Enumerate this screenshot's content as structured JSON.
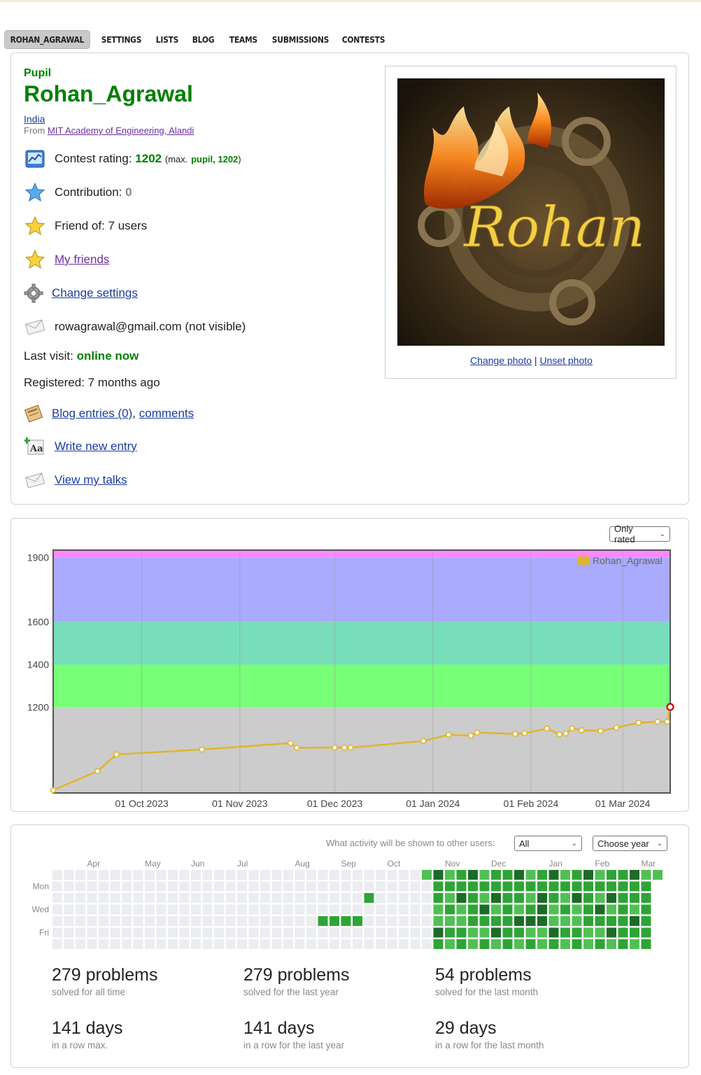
{
  "tabs": [
    "ROHAN_AGRAWAL",
    "SETTINGS",
    "LISTS",
    "BLOG",
    "TEAMS",
    "SUBMISSIONS",
    "CONTESTS"
  ],
  "profile": {
    "rank": "Pupil",
    "handle": "Rohan_Agrawal",
    "country": "India",
    "from_prefix": "From",
    "organization": "MIT Academy of Engineering, Alandi",
    "rating_label": "Contest rating:",
    "rating": "1202",
    "max_prefix": "(max.",
    "max_rank": "pupil, 1202",
    "max_suffix": ")",
    "contribution_label": "Contribution:",
    "contribution": "0",
    "friend_of": "Friend of: 7 users",
    "my_friends": "My friends",
    "change_settings": "Change settings",
    "email": "rowagrawal@gmail.com (not visible)",
    "last_visit_label": "Last visit:",
    "last_visit": "online now",
    "registered": "Registered: 7 months ago",
    "blog_entries": "Blog entries (0)",
    "comma": ",",
    "comments": "comments",
    "write_new_entry": "Write new entry",
    "view_my_talks": "View my talks",
    "photo_text": "Rohan",
    "change_photo": "Change photo",
    "separator": "|",
    "unset_photo": "Unset photo"
  },
  "rating_filter": "Only rated",
  "colors": {
    "accent_green": "#008000",
    "link": "#1a3ca0",
    "line": "#e0b52e",
    "band_gray": "#cccccc",
    "band_green": "#77ff77",
    "band_cyan": "#77ddbb",
    "band_blue": "#aaaaff",
    "band_pink": "#ff88ff"
  },
  "chart_data": {
    "type": "line",
    "series": [
      {
        "name": "Rohan_Agrawal",
        "points": [
          [
            "2023-09-03",
            813
          ],
          [
            "2023-09-17",
            902
          ],
          [
            "2023-09-23",
            980
          ],
          [
            "2023-10-20",
            1003
          ],
          [
            "2023-11-17",
            1033
          ],
          [
            "2023-11-19",
            1011
          ],
          [
            "2023-12-01",
            1012
          ],
          [
            "2023-12-04",
            1012
          ],
          [
            "2023-12-06",
            1012
          ],
          [
            "2023-12-29",
            1043
          ],
          [
            "2024-01-06",
            1072
          ],
          [
            "2024-01-13",
            1068
          ],
          [
            "2024-01-15",
            1082
          ],
          [
            "2024-01-27",
            1076
          ],
          [
            "2024-01-30",
            1079
          ],
          [
            "2024-02-06",
            1101
          ],
          [
            "2024-02-10",
            1074
          ],
          [
            "2024-02-12",
            1078
          ],
          [
            "2024-02-14",
            1102
          ],
          [
            "2024-02-17",
            1093
          ],
          [
            "2024-02-23",
            1090
          ],
          [
            "2024-02-28",
            1105
          ],
          [
            "2024-03-06",
            1128
          ],
          [
            "2024-03-12",
            1133
          ],
          [
            "2024-03-15",
            1133
          ],
          [
            "2024-03-16",
            1202
          ]
        ]
      }
    ],
    "x_range": [
      "2023-09-03",
      "2024-03-16"
    ],
    "xticks": [
      "01 Oct 2023",
      "01 Nov 2023",
      "01 Dec 2023",
      "01 Jan 2024",
      "01 Feb 2024",
      "01 Mar 2024"
    ],
    "xtick_dates": [
      "2023-10-01",
      "2023-11-01",
      "2023-12-01",
      "2024-01-01",
      "2024-02-01",
      "2024-03-01"
    ],
    "ylim": [
      800,
      1935
    ],
    "yticks": [
      1200,
      1400,
      1600,
      1900
    ],
    "bands": [
      {
        "from": 800,
        "to": 1200,
        "color": "#cccccc"
      },
      {
        "from": 1200,
        "to": 1400,
        "color": "#77ff77"
      },
      {
        "from": 1400,
        "to": 1600,
        "color": "#77ddbb"
      },
      {
        "from": 1600,
        "to": 1900,
        "color": "#aaaaff"
      },
      {
        "from": 1900,
        "to": 1935,
        "color": "#ff88ff"
      }
    ],
    "legend": "top-right",
    "grid": true
  },
  "activity": {
    "visibility_label": "What activity will be shown to other users:",
    "visibility_value": "All",
    "year_select": "Choose year",
    "months": [
      "Apr",
      "May",
      "Jun",
      "Jul",
      "Aug",
      "Sep",
      "Oct",
      "Nov",
      "Dec",
      "Jan",
      "Feb",
      "Mar"
    ],
    "weekday_labels": [
      "Mon",
      "Wed",
      "Fri"
    ],
    "stats": [
      {
        "value": "279 problems",
        "label": "solved for all time"
      },
      {
        "value": "279 problems",
        "label": "solved for the last year"
      },
      {
        "value": "54 problems",
        "label": "solved for the last month"
      },
      {
        "value": "141 days",
        "label": "in a row max."
      },
      {
        "value": "141 days",
        "label": "in a row for the last year"
      },
      {
        "value": "29 days",
        "label": "in a row for the last month"
      }
    ]
  }
}
